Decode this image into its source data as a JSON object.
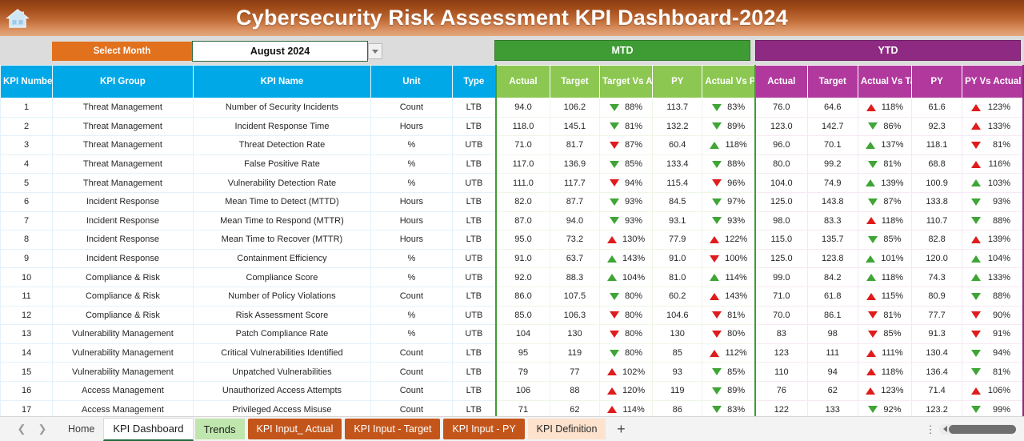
{
  "banner": {
    "title": "Cybersecurity Risk Assessment KPI Dashboard-2024",
    "home_icon": "home-icon",
    "gradient_from": "#8a3c13",
    "gradient_to": "#e3a87e"
  },
  "controls": {
    "select_month_label": "Select Month",
    "selected_month": "August 2024",
    "dropdown_icon": "chevron-down-icon"
  },
  "groups": {
    "mtd": {
      "label": "MTD",
      "color": "#3f9c35"
    },
    "ytd": {
      "label": "YTD",
      "color": "#8e2a82"
    }
  },
  "headers": {
    "info": [
      "KPI Number",
      "KPI Group",
      "KPI Name",
      "Unit",
      "Type"
    ],
    "mtd": [
      "Actual",
      "Target",
      "Target Vs Actual",
      "PY",
      "Actual Vs PY"
    ],
    "ytd": [
      "Actual",
      "Target",
      "Actual Vs Target",
      "PY",
      "PY Vs Actual"
    ],
    "info_color": "#00a8e8",
    "mtd_color": "#8cc751",
    "ytd_color": "#b1399e"
  },
  "rows": [
    {
      "num": "1",
      "group": "Threat Management",
      "name": "Number of Security Incidents",
      "unit": "Count",
      "type": "LTB",
      "mtd_actual": "94.0",
      "mtd_target": "106.2",
      "mtd_tva": {
        "pct": "88%",
        "dir": "down",
        "color": "g"
      },
      "mtd_py": "113.7",
      "mtd_avp": {
        "pct": "83%",
        "dir": "down",
        "color": "g"
      },
      "ytd_actual": "76.0",
      "ytd_target": "64.6",
      "ytd_avt": {
        "pct": "118%",
        "dir": "up",
        "color": "r"
      },
      "ytd_py": "61.6",
      "ytd_pva": {
        "pct": "123%",
        "dir": "up",
        "color": "r"
      }
    },
    {
      "num": "2",
      "group": "Threat Management",
      "name": "Incident Response Time",
      "unit": "Hours",
      "type": "LTB",
      "mtd_actual": "118.0",
      "mtd_target": "145.1",
      "mtd_tva": {
        "pct": "81%",
        "dir": "down",
        "color": "g"
      },
      "mtd_py": "132.2",
      "mtd_avp": {
        "pct": "89%",
        "dir": "down",
        "color": "g"
      },
      "ytd_actual": "123.0",
      "ytd_target": "142.7",
      "ytd_avt": {
        "pct": "86%",
        "dir": "down",
        "color": "g"
      },
      "ytd_py": "92.3",
      "ytd_pva": {
        "pct": "133%",
        "dir": "up",
        "color": "r"
      }
    },
    {
      "num": "3",
      "group": "Threat Management",
      "name": "Threat Detection Rate",
      "unit": "%",
      "type": "UTB",
      "mtd_actual": "71.0",
      "mtd_target": "81.7",
      "mtd_tva": {
        "pct": "87%",
        "dir": "down",
        "color": "r"
      },
      "mtd_py": "60.4",
      "mtd_avp": {
        "pct": "118%",
        "dir": "up",
        "color": "g"
      },
      "ytd_actual": "96.0",
      "ytd_target": "70.1",
      "ytd_avt": {
        "pct": "137%",
        "dir": "up",
        "color": "g"
      },
      "ytd_py": "118.1",
      "ytd_pva": {
        "pct": "81%",
        "dir": "down",
        "color": "r"
      }
    },
    {
      "num": "4",
      "group": "Threat Management",
      "name": "False Positive Rate",
      "unit": "%",
      "type": "LTB",
      "mtd_actual": "117.0",
      "mtd_target": "136.9",
      "mtd_tva": {
        "pct": "85%",
        "dir": "down",
        "color": "g"
      },
      "mtd_py": "133.4",
      "mtd_avp": {
        "pct": "88%",
        "dir": "down",
        "color": "g"
      },
      "ytd_actual": "80.0",
      "ytd_target": "99.2",
      "ytd_avt": {
        "pct": "81%",
        "dir": "down",
        "color": "g"
      },
      "ytd_py": "68.8",
      "ytd_pva": {
        "pct": "116%",
        "dir": "up",
        "color": "r"
      }
    },
    {
      "num": "5",
      "group": "Threat Management",
      "name": "Vulnerability Detection Rate",
      "unit": "%",
      "type": "UTB",
      "mtd_actual": "111.0",
      "mtd_target": "117.7",
      "mtd_tva": {
        "pct": "94%",
        "dir": "down",
        "color": "r"
      },
      "mtd_py": "115.4",
      "mtd_avp": {
        "pct": "96%",
        "dir": "down",
        "color": "r"
      },
      "ytd_actual": "104.0",
      "ytd_target": "74.9",
      "ytd_avt": {
        "pct": "139%",
        "dir": "up",
        "color": "g"
      },
      "ytd_py": "100.9",
      "ytd_pva": {
        "pct": "103%",
        "dir": "up",
        "color": "g"
      }
    },
    {
      "num": "6",
      "group": "Incident Response",
      "name": "Mean Time to Detect (MTTD)",
      "unit": "Hours",
      "type": "LTB",
      "mtd_actual": "82.0",
      "mtd_target": "87.7",
      "mtd_tva": {
        "pct": "93%",
        "dir": "down",
        "color": "g"
      },
      "mtd_py": "84.5",
      "mtd_avp": {
        "pct": "97%",
        "dir": "down",
        "color": "g"
      },
      "ytd_actual": "125.0",
      "ytd_target": "143.8",
      "ytd_avt": {
        "pct": "87%",
        "dir": "down",
        "color": "g"
      },
      "ytd_py": "133.8",
      "ytd_pva": {
        "pct": "93%",
        "dir": "down",
        "color": "g"
      }
    },
    {
      "num": "7",
      "group": "Incident Response",
      "name": "Mean Time to Respond (MTTR)",
      "unit": "Hours",
      "type": "LTB",
      "mtd_actual": "87.0",
      "mtd_target": "94.0",
      "mtd_tva": {
        "pct": "93%",
        "dir": "down",
        "color": "g"
      },
      "mtd_py": "93.1",
      "mtd_avp": {
        "pct": "93%",
        "dir": "down",
        "color": "g"
      },
      "ytd_actual": "98.0",
      "ytd_target": "83.3",
      "ytd_avt": {
        "pct": "118%",
        "dir": "up",
        "color": "r"
      },
      "ytd_py": "110.7",
      "ytd_pva": {
        "pct": "88%",
        "dir": "down",
        "color": "g"
      }
    },
    {
      "num": "8",
      "group": "Incident Response",
      "name": "Mean Time to Recover (MTTR)",
      "unit": "Hours",
      "type": "LTB",
      "mtd_actual": "95.0",
      "mtd_target": "73.2",
      "mtd_tva": {
        "pct": "130%",
        "dir": "up",
        "color": "r"
      },
      "mtd_py": "77.9",
      "mtd_avp": {
        "pct": "122%",
        "dir": "up",
        "color": "r"
      },
      "ytd_actual": "115.0",
      "ytd_target": "135.7",
      "ytd_avt": {
        "pct": "85%",
        "dir": "down",
        "color": "g"
      },
      "ytd_py": "82.8",
      "ytd_pva": {
        "pct": "139%",
        "dir": "up",
        "color": "r"
      }
    },
    {
      "num": "9",
      "group": "Incident Response",
      "name": "Containment Efficiency",
      "unit": "%",
      "type": "UTB",
      "mtd_actual": "91.0",
      "mtd_target": "63.7",
      "mtd_tva": {
        "pct": "143%",
        "dir": "up",
        "color": "g"
      },
      "mtd_py": "91.0",
      "mtd_avp": {
        "pct": "100%",
        "dir": "down",
        "color": "r"
      },
      "ytd_actual": "125.0",
      "ytd_target": "123.8",
      "ytd_avt": {
        "pct": "101%",
        "dir": "up",
        "color": "g"
      },
      "ytd_py": "120.0",
      "ytd_pva": {
        "pct": "104%",
        "dir": "up",
        "color": "g"
      }
    },
    {
      "num": "10",
      "group": "Compliance & Risk",
      "name": "Compliance Score",
      "unit": "%",
      "type": "UTB",
      "mtd_actual": "92.0",
      "mtd_target": "88.3",
      "mtd_tva": {
        "pct": "104%",
        "dir": "up",
        "color": "g"
      },
      "mtd_py": "81.0",
      "mtd_avp": {
        "pct": "114%",
        "dir": "up",
        "color": "g"
      },
      "ytd_actual": "99.0",
      "ytd_target": "84.2",
      "ytd_avt": {
        "pct": "118%",
        "dir": "up",
        "color": "g"
      },
      "ytd_py": "74.3",
      "ytd_pva": {
        "pct": "133%",
        "dir": "up",
        "color": "g"
      }
    },
    {
      "num": "11",
      "group": "Compliance & Risk",
      "name": "Number of Policy Violations",
      "unit": "Count",
      "type": "LTB",
      "mtd_actual": "86.0",
      "mtd_target": "107.5",
      "mtd_tva": {
        "pct": "80%",
        "dir": "down",
        "color": "g"
      },
      "mtd_py": "60.2",
      "mtd_avp": {
        "pct": "143%",
        "dir": "up",
        "color": "r"
      },
      "ytd_actual": "71.0",
      "ytd_target": "61.8",
      "ytd_avt": {
        "pct": "115%",
        "dir": "up",
        "color": "r"
      },
      "ytd_py": "80.9",
      "ytd_pva": {
        "pct": "88%",
        "dir": "down",
        "color": "g"
      }
    },
    {
      "num": "12",
      "group": "Compliance & Risk",
      "name": "Risk Assessment Score",
      "unit": "%",
      "type": "UTB",
      "mtd_actual": "85.0",
      "mtd_target": "106.3",
      "mtd_tva": {
        "pct": "80%",
        "dir": "down",
        "color": "r"
      },
      "mtd_py": "104.6",
      "mtd_avp": {
        "pct": "81%",
        "dir": "down",
        "color": "r"
      },
      "ytd_actual": "70.0",
      "ytd_target": "86.1",
      "ytd_avt": {
        "pct": "81%",
        "dir": "down",
        "color": "r"
      },
      "ytd_py": "77.7",
      "ytd_pva": {
        "pct": "90%",
        "dir": "down",
        "color": "r"
      }
    },
    {
      "num": "13",
      "group": "Vulnerability Management",
      "name": "Patch Compliance Rate",
      "unit": "%",
      "type": "UTB",
      "mtd_actual": "104",
      "mtd_target": "130",
      "mtd_tva": {
        "pct": "80%",
        "dir": "down",
        "color": "r"
      },
      "mtd_py": "130",
      "mtd_avp": {
        "pct": "80%",
        "dir": "down",
        "color": "r"
      },
      "ytd_actual": "83",
      "ytd_target": "98",
      "ytd_avt": {
        "pct": "85%",
        "dir": "down",
        "color": "r"
      },
      "ytd_py": "91.3",
      "ytd_pva": {
        "pct": "91%",
        "dir": "down",
        "color": "r"
      }
    },
    {
      "num": "14",
      "group": "Vulnerability Management",
      "name": "Critical Vulnerabilities Identified",
      "unit": "Count",
      "type": "LTB",
      "mtd_actual": "95",
      "mtd_target": "119",
      "mtd_tva": {
        "pct": "80%",
        "dir": "down",
        "color": "g"
      },
      "mtd_py": "85",
      "mtd_avp": {
        "pct": "112%",
        "dir": "up",
        "color": "r"
      },
      "ytd_actual": "123",
      "ytd_target": "111",
      "ytd_avt": {
        "pct": "111%",
        "dir": "up",
        "color": "r"
      },
      "ytd_py": "130.4",
      "ytd_pva": {
        "pct": "94%",
        "dir": "down",
        "color": "g"
      }
    },
    {
      "num": "15",
      "group": "Vulnerability Management",
      "name": "Unpatched Vulnerabilities",
      "unit": "Count",
      "type": "LTB",
      "mtd_actual": "79",
      "mtd_target": "77",
      "mtd_tva": {
        "pct": "102%",
        "dir": "up",
        "color": "r"
      },
      "mtd_py": "93",
      "mtd_avp": {
        "pct": "85%",
        "dir": "down",
        "color": "g"
      },
      "ytd_actual": "110",
      "ytd_target": "94",
      "ytd_avt": {
        "pct": "118%",
        "dir": "up",
        "color": "r"
      },
      "ytd_py": "136.4",
      "ytd_pva": {
        "pct": "81%",
        "dir": "down",
        "color": "g"
      }
    },
    {
      "num": "16",
      "group": "Access Management",
      "name": "Unauthorized Access Attempts",
      "unit": "Count",
      "type": "LTB",
      "mtd_actual": "106",
      "mtd_target": "88",
      "mtd_tva": {
        "pct": "120%",
        "dir": "up",
        "color": "r"
      },
      "mtd_py": "119",
      "mtd_avp": {
        "pct": "89%",
        "dir": "down",
        "color": "g"
      },
      "ytd_actual": "76",
      "ytd_target": "62",
      "ytd_avt": {
        "pct": "123%",
        "dir": "up",
        "color": "r"
      },
      "ytd_py": "71.4",
      "ytd_pva": {
        "pct": "106%",
        "dir": "up",
        "color": "r"
      }
    },
    {
      "num": "17",
      "group": "Access Management",
      "name": "Privileged Access Misuse",
      "unit": "Count",
      "type": "LTB",
      "mtd_actual": "71",
      "mtd_target": "62",
      "mtd_tva": {
        "pct": "114%",
        "dir": "up",
        "color": "r"
      },
      "mtd_py": "86",
      "mtd_avp": {
        "pct": "83%",
        "dir": "down",
        "color": "g"
      },
      "ytd_actual": "122",
      "ytd_target": "133",
      "ytd_avt": {
        "pct": "92%",
        "dir": "down",
        "color": "g"
      },
      "ytd_py": "123.2",
      "ytd_pva": {
        "pct": "99%",
        "dir": "down",
        "color": "g"
      }
    }
  ],
  "tabbar": {
    "prev_icon": "chevron-left-icon",
    "next_icon": "chevron-right-icon",
    "tabs": [
      {
        "label": "Home",
        "style": "plain"
      },
      {
        "label": "KPI Dashboard",
        "style": "active"
      },
      {
        "label": "Trends",
        "style": "green"
      },
      {
        "label": "KPI Input_ Actual",
        "style": "orange"
      },
      {
        "label": "KPI Input - Target",
        "style": "orange"
      },
      {
        "label": "KPI Input - PY",
        "style": "orange"
      },
      {
        "label": "KPI Definition",
        "style": "peach"
      }
    ],
    "add_sheet_icon": "plus-icon",
    "kebab_icon": "more-vertical-icon",
    "scroll_icon": "horizontal-scrollbar"
  }
}
